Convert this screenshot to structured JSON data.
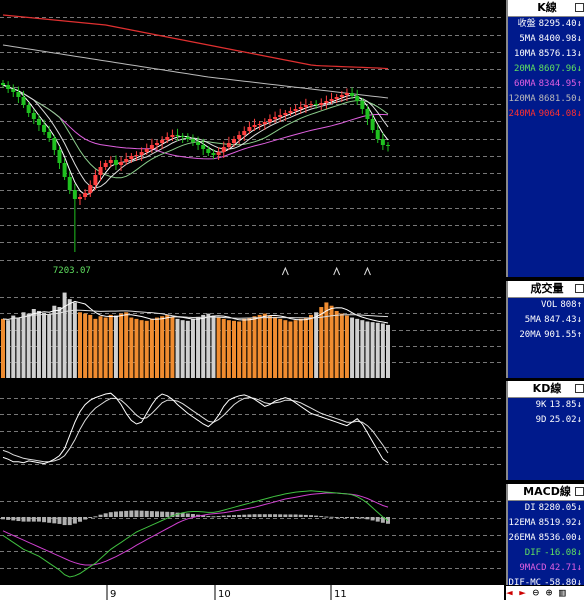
{
  "colors": {
    "up": "#ff4040",
    "down": "#20c020",
    "ma5": "#ffffff",
    "ma10": "#dddddd",
    "ma20": "#8ccf8c",
    "ma60": "#e060e0",
    "ma120": "#bbbbbb",
    "ma240": "#e03030",
    "vol_up": "#f08c30",
    "vol_down": "#d0d0d0",
    "k": "#ffffff",
    "d": "#dddddd",
    "dif": "#40c040",
    "macd": "#d040d0",
    "osc": "#b0b0b0"
  },
  "k_panel": {
    "title": "K線",
    "rows": [
      {
        "label": "收盤",
        "value": "8295.40",
        "arrow": "↓",
        "color": "#ffffff"
      },
      {
        "label": "5MA",
        "value": "8400.98",
        "arrow": "↓",
        "color": "#ffffff"
      },
      {
        "label": "10MA",
        "value": "8576.13",
        "arrow": "↓",
        "color": "#ffffff"
      },
      {
        "label": "20MA",
        "value": "8607.96",
        "arrow": "↓",
        "color": "#60e060"
      },
      {
        "label": "60MA",
        "value": "8344.95",
        "arrow": "↑",
        "color": "#e060e0"
      },
      {
        "label": "120MA",
        "value": "8681.50",
        "arrow": "↓",
        "color": "#bbbbbb"
      },
      {
        "label": "240MA",
        "value": "9064.08",
        "arrow": "↓",
        "color": "#ff3030"
      }
    ],
    "low_label": "7203.07"
  },
  "vol_panel": {
    "title": "成交量",
    "rows": [
      {
        "label": "VOL",
        "value": "808",
        "arrow": "↑",
        "color": "#ffffff"
      },
      {
        "label": "5MA",
        "value": "847.43",
        "arrow": "↓",
        "color": "#ffffff"
      },
      {
        "label": "20MA",
        "value": "901.55",
        "arrow": "↑",
        "color": "#ffffff"
      }
    ]
  },
  "kd_panel": {
    "title": "KD線",
    "rows": [
      {
        "label": "9K",
        "value": "13.85",
        "arrow": "↓",
        "color": "#ffffff"
      },
      {
        "label": "9D",
        "value": "25.02",
        "arrow": "↓",
        "color": "#ffffff"
      }
    ]
  },
  "macd_panel": {
    "title": "MACD線",
    "rows": [
      {
        "label": "DI",
        "value": "8280.05",
        "arrow": "↓",
        "color": "#ffffff"
      },
      {
        "label": "12EMA",
        "value": "8519.92",
        "arrow": "↓",
        "color": "#ffffff"
      },
      {
        "label": "26EMA",
        "value": "8536.00",
        "arrow": "↓",
        "color": "#ffffff"
      },
      {
        "label": "DIF",
        "value": "-16.08",
        "arrow": "↓",
        "color": "#60e060"
      },
      {
        "label": "9MACD",
        "value": "42.71",
        "arrow": "↓",
        "color": "#e060e0"
      },
      {
        "label": "DIF-MC",
        "value": "-58.80",
        "arrow": "↓",
        "color": "#ffffff"
      }
    ]
  },
  "x_axis": {
    "labels": [
      "9",
      "10",
      "11"
    ]
  },
  "nav": {
    "prev": "◄",
    "next": "►",
    "zoom_out": "⊖",
    "zoom_in": "⊕",
    "chart_icon": "▥"
  },
  "chart_data": {
    "type": "candlestick",
    "k_lines": {
      "n": 76,
      "low_annotation": 7203.07,
      "close": [
        8900,
        8860,
        8830,
        8780,
        8700,
        8620,
        8560,
        8500,
        8430,
        8370,
        8250,
        8120,
        7980,
        7850,
        7760,
        7780,
        7820,
        7900,
        8000,
        8080,
        8120,
        8150,
        8100,
        8130,
        8160,
        8190,
        8200,
        8230,
        8260,
        8300,
        8320,
        8350,
        8380,
        8400,
        8390,
        8380,
        8360,
        8330,
        8300,
        8260,
        8220,
        8200,
        8230,
        8280,
        8320,
        8360,
        8400,
        8440,
        8480,
        8500,
        8510,
        8530,
        8560,
        8580,
        8600,
        8620,
        8640,
        8660,
        8680,
        8700,
        8710,
        8700,
        8720,
        8740,
        8760,
        8780,
        8800,
        8820,
        8790,
        8740,
        8660,
        8560,
        8450,
        8360,
        8300,
        8295.4
      ],
      "ma240": [
        9600,
        9595,
        9590,
        9585,
        9580,
        9575,
        9570,
        9565,
        9560,
        9555,
        9550,
        9545,
        9540,
        9535,
        9530,
        9525,
        9520,
        9515,
        9510,
        9505,
        9500,
        9490,
        9480,
        9470,
        9460,
        9450,
        9440,
        9430,
        9420,
        9410,
        9400,
        9390,
        9380,
        9370,
        9360,
        9350,
        9340,
        9330,
        9320,
        9310,
        9300,
        9290,
        9280,
        9270,
        9260,
        9250,
        9240,
        9230,
        9220,
        9210,
        9200,
        9190,
        9180,
        9170,
        9160,
        9150,
        9140,
        9130,
        9120,
        9110,
        9100,
        9095,
        9092,
        9090,
        9088,
        9086,
        9084,
        9082,
        9080,
        9078,
        9076,
        9074,
        9072,
        9070,
        9067,
        9064.08
      ]
    },
    "volume": [
      900,
      880,
      950,
      920,
      1000,
      980,
      1050,
      1020,
      990,
      970,
      1100,
      1080,
      1300,
      1200,
      1150,
      1000,
      980,
      960,
      900,
      940,
      920,
      960,
      950,
      980,
      1000,
      920,
      900,
      880,
      870,
      900,
      920,
      940,
      960,
      930,
      900,
      880,
      870,
      900,
      930,
      960,
      980,
      950,
      920,
      900,
      880,
      870,
      860,
      900,
      920,
      940,
      960,
      980,
      950,
      930,
      900,
      880,
      860,
      880,
      900,
      920,
      960,
      1000,
      1080,
      1150,
      1100,
      1020,
      980,
      950,
      920,
      900,
      880,
      860,
      850,
      840,
      830,
      808
    ],
    "kd": {
      "k": [
        20,
        18,
        15,
        15,
        14,
        16,
        15,
        14,
        13,
        15,
        18,
        22,
        30,
        45,
        60,
        72,
        80,
        85,
        88,
        90,
        92,
        93,
        88,
        80,
        70,
        62,
        58,
        60,
        70,
        80,
        88,
        92,
        90,
        86,
        80,
        75,
        70,
        66,
        62,
        58,
        55,
        60,
        68,
        78,
        85,
        88,
        90,
        91,
        89,
        86,
        82,
        78,
        80,
        84,
        86,
        88,
        86,
        82,
        78,
        74,
        70,
        68,
        66,
        64,
        62,
        60,
        58,
        56,
        60,
        64,
        58,
        48,
        38,
        28,
        18,
        13.85
      ],
      "d": [
        28,
        26,
        23,
        21,
        19,
        18,
        17,
        16,
        15,
        15,
        16,
        18,
        22,
        30,
        40,
        52,
        62,
        70,
        76,
        80,
        84,
        87,
        87,
        85,
        80,
        74,
        68,
        64,
        65,
        70,
        76,
        82,
        85,
        85,
        84,
        81,
        77,
        73,
        69,
        65,
        61,
        60,
        63,
        68,
        74,
        80,
        84,
        87,
        88,
        87,
        85,
        82,
        81,
        82,
        83,
        85,
        85,
        84,
        82,
        79,
        76,
        73,
        70,
        68,
        66,
        64,
        62,
        60,
        60,
        61,
        60,
        56,
        50,
        42,
        34,
        25.02
      ]
    },
    "macd": {
      "dif": [
        -80,
        -95,
        -110,
        -125,
        -140,
        -150,
        -160,
        -170,
        -185,
        -200,
        -215,
        -230,
        -250,
        -260,
        -255,
        -245,
        -230,
        -215,
        -200,
        -180,
        -160,
        -140,
        -125,
        -110,
        -95,
        -80,
        -65,
        -55,
        -45,
        -35,
        -25,
        -15,
        -5,
        5,
        12,
        18,
        22,
        24,
        24,
        22,
        20,
        20,
        24,
        30,
        36,
        42,
        48,
        54,
        60,
        66,
        72,
        78,
        84,
        90,
        95,
        100,
        104,
        108,
        110,
        112,
        114,
        112,
        110,
        108,
        106,
        104,
        102,
        100,
        96,
        88,
        76,
        60,
        40,
        20,
        0,
        -16.08
      ],
      "macd": [
        -60,
        -70,
        -80,
        -90,
        -100,
        -110,
        -120,
        -130,
        -140,
        -150,
        -160,
        -170,
        -180,
        -190,
        -198,
        -204,
        -208,
        -208,
        -206,
        -200,
        -192,
        -182,
        -172,
        -160,
        -148,
        -136,
        -122,
        -110,
        -98,
        -86,
        -74,
        -62,
        -50,
        -38,
        -26,
        -16,
        -8,
        -2,
        4,
        8,
        12,
        14,
        16,
        18,
        22,
        26,
        30,
        34,
        38,
        42,
        48,
        54,
        60,
        66,
        72,
        78,
        82,
        86,
        90,
        94,
        98,
        100,
        102,
        104,
        104,
        104,
        102,
        100,
        98,
        94,
        88,
        80,
        70,
        60,
        50,
        42.71
      ]
    }
  }
}
